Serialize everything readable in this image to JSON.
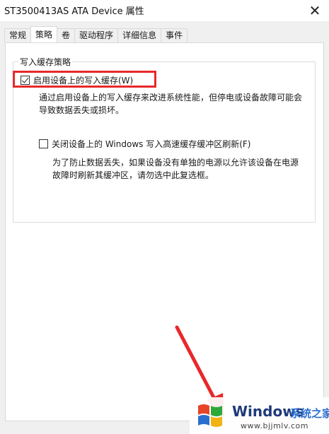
{
  "window": {
    "title": "ST3500413AS ATA Device 属性",
    "close_glyph": "✕"
  },
  "tabs": [
    {
      "label": "常规",
      "active": false
    },
    {
      "label": "策略",
      "active": true
    },
    {
      "label": "卷",
      "active": false
    },
    {
      "label": "驱动程序",
      "active": false
    },
    {
      "label": "详细信息",
      "active": false
    },
    {
      "label": "事件",
      "active": false
    }
  ],
  "write_cache": {
    "group_title": "写入缓存策略",
    "enable_option": {
      "label": "启用设备上的写入缓存(W)",
      "checked": true,
      "description_line1": "通过启用设备上的写入缓存来改进系统性能，但停电或设备故障可能会",
      "description_line2": "导致数据丢失或损坏。"
    },
    "flush_option": {
      "label": "关闭设备上的 Windows 写入高速缓存缓冲区刷新(F)",
      "checked": false,
      "description_line1": "为了防止数据丢失，如果设备没有单独的电源以允许该设备在电源",
      "description_line2": "故障时刷新其缓冲区，请勿选中此复选框。"
    }
  },
  "annotation": {
    "highlight_color": "#e8282a",
    "arrow_color": "#e8282a"
  },
  "watermark": {
    "brand": "Windows",
    "brand_cn": "系统之家",
    "url": "www.bjjmlv.com"
  }
}
